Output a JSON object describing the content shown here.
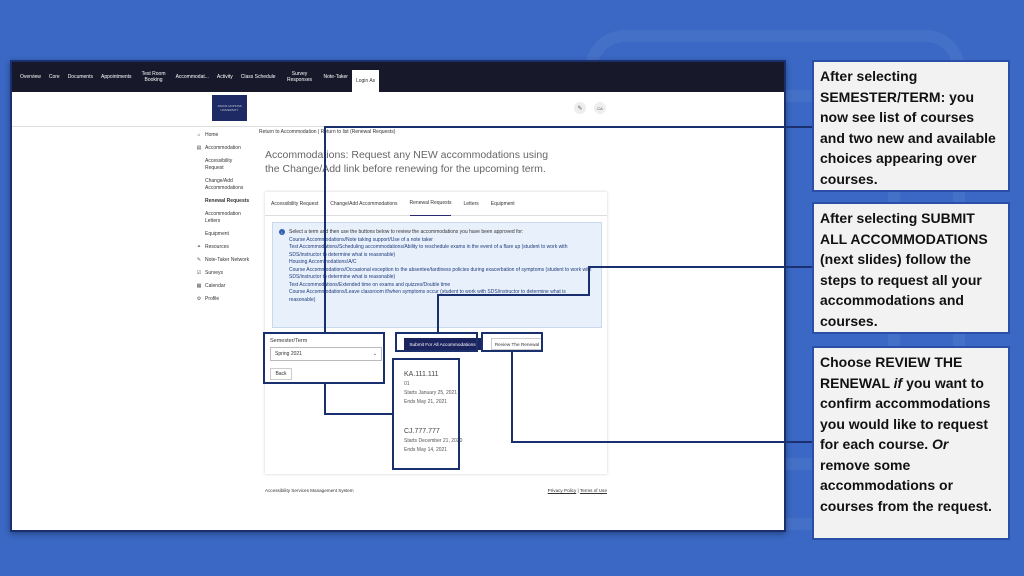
{
  "top_nav": [
    "Overview",
    "Core",
    "Documents",
    "Appointments",
    "Test Room Booking",
    "Accommodat...",
    "Activity",
    "Class Schedule",
    "Survey Responses",
    "Note-Taker",
    "Login As"
  ],
  "logo_text": "JOHNS HOPKINS UNIVERSITY",
  "header_icons": {
    "edit_icon": "✎",
    "avatar_initials": "CA"
  },
  "sidebar": {
    "home": "Home",
    "accommodation": "Accommodation",
    "sub_items": [
      "Accessibility Request",
      "Change/Add Accommodations",
      "Renewal Requests",
      "Accommodation Letters",
      "Equipment"
    ],
    "resources": "Resources",
    "note_taker": "Note-Taker Network",
    "surveys": "Surveys",
    "calendar": "Calendar",
    "profile": "Profile"
  },
  "breadcrumb": {
    "part1": "Return to Accommodation",
    "sep": " | ",
    "part2": "Return to list (Renewal Requests)"
  },
  "page_title": "Accommodations: Request any NEW accommodations using the Change/Add link before renewing for the upcoming term.",
  "tabs": [
    "Accessibility Request",
    "Change/Add Accommodations",
    "Renewal Requests",
    "Letters",
    "Equipment"
  ],
  "info": {
    "intro": "Select a term and then use the buttons below to review the accommodations you have been approved for:",
    "lines": [
      "Course Accommodations/Note taking support/Use of a note taker",
      "Test Accommodations/Scheduling accommodations/Ability to reschedule exams in the event of a flare up (student to work with SDS/instructor to determine what is reasonable)",
      "Housing Accommodations/A/C",
      "Course Accommodations/Occasional exception to the absentee/tardiness policies during exacerbation of symptoms (student to work with SDS/instructor to determine what is reasonable)",
      "Test Accommodations/Extended time on exams and quizzes/Double time",
      "Course Accommodations/Leave classroom if/when symptoms occur (student to work with SDS/instructor to determine what is reasonable)"
    ]
  },
  "semester": {
    "label": "Semester/Term",
    "value": "Spring 2021",
    "back": "Back"
  },
  "buttons": {
    "submit_all": "Submit For All Accommodations",
    "review": "Review The Renewal"
  },
  "courses": [
    {
      "code": "KA.111.111",
      "section": "01",
      "starts": "Starts January 25, 2021",
      "ends": "Ends May 21, 2021"
    },
    {
      "code": "CJ.777.777",
      "starts": "Starts December 21, 2020",
      "ends": "Ends May 14, 2021"
    }
  ],
  "footer": {
    "left": "Accessibility Services Management System",
    "privacy": "Privacy Policy",
    "sep": " | ",
    "terms": "Terms of Use"
  },
  "callouts": {
    "c1": "After selecting SEMESTER/TERM: you now see list of courses and two new and available choices appearing over courses.",
    "c2": "After selecting SUBMIT ALL ACCOMMODATIONS (next slides) follow the steps to request all your accommodations and courses.",
    "c3_a": "Choose REVIEW THE RENEWAL ",
    "c3_b": "if",
    "c3_c": " you want to confirm accommodations you would like to request for each course. ",
    "c3_d": "Or",
    "c3_e": " remove some accommodations or courses from the request."
  },
  "colors": {
    "background": "#3a68c4",
    "nav": "#17182a",
    "accent": "#1c2460",
    "callout_border": "#2a4fa8"
  }
}
